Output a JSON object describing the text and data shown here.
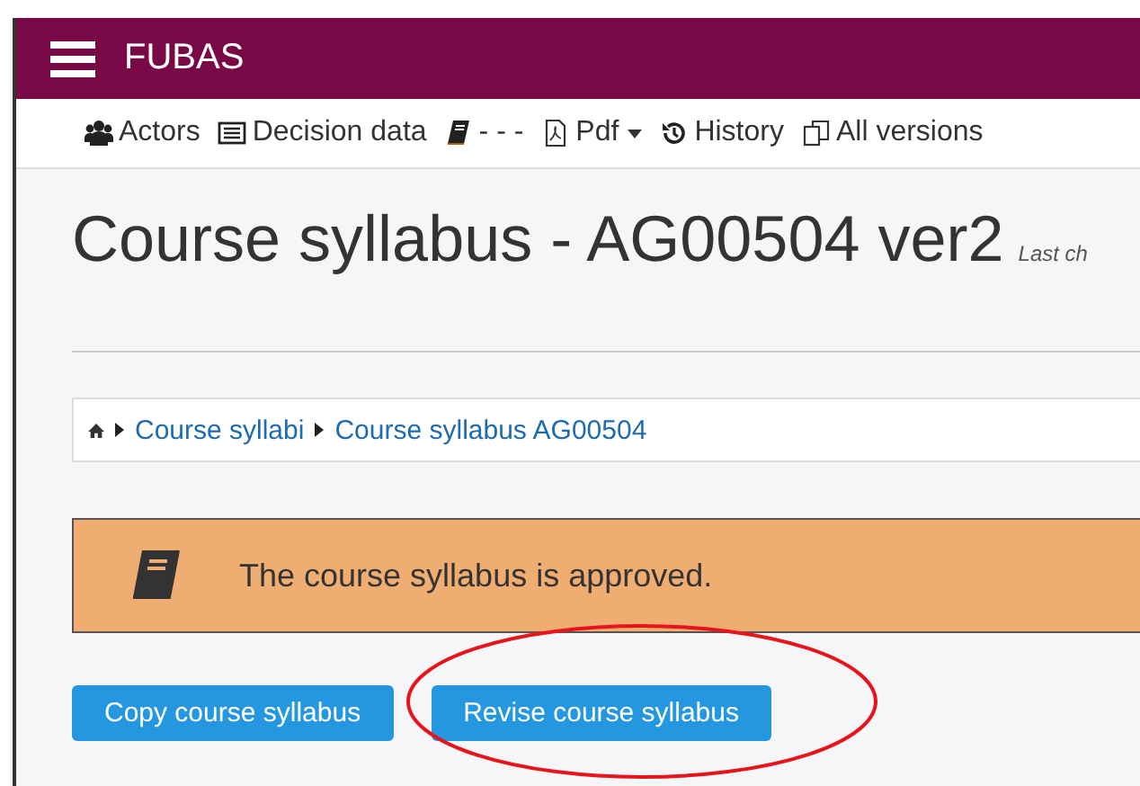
{
  "app": {
    "title": "FUBAS"
  },
  "toolbar": [
    {
      "kind": "users",
      "label": "Actors",
      "dropdown": false
    },
    {
      "kind": "list",
      "label": "Decision data",
      "dropdown": false
    },
    {
      "kind": "book",
      "label": "- - -",
      "dropdown": false
    },
    {
      "kind": "pdf",
      "label": "Pdf",
      "dropdown": true
    },
    {
      "kind": "history",
      "label": "History",
      "dropdown": false
    },
    {
      "kind": "copies",
      "label": "All versions",
      "dropdown": false
    }
  ],
  "page": {
    "title": "Course syllabus - AG00504 ver2",
    "subtitle": "Last ch"
  },
  "breadcrumb": [
    "Course syllabi",
    "Course syllabus AG00504"
  ],
  "alert": {
    "text": "The course syllabus is approved."
  },
  "buttons": [
    {
      "label": "Copy course syllabus",
      "highlighted": false
    },
    {
      "label": "Revise course syllabus",
      "highlighted": true
    }
  ]
}
